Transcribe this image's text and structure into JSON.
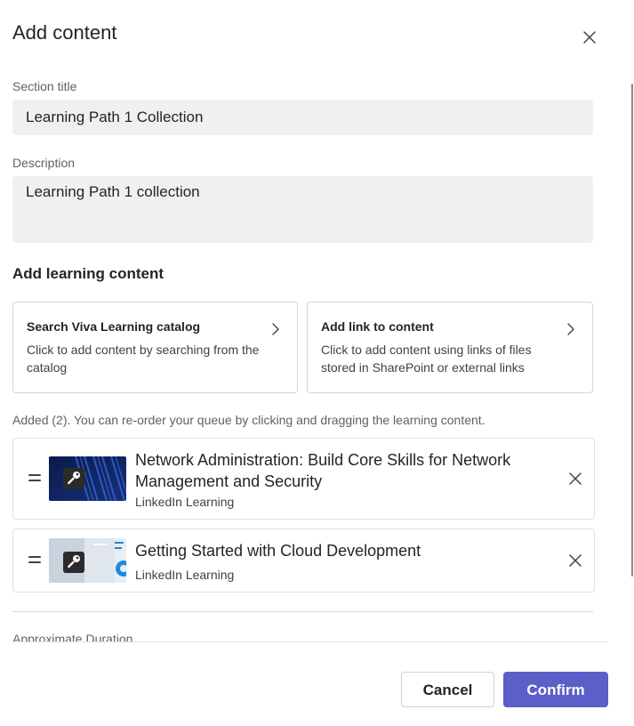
{
  "dialog": {
    "title": "Add content"
  },
  "form": {
    "section_title_label": "Section title",
    "section_title_value": "Learning Path 1 Collection",
    "description_label": "Description",
    "description_value": "Learning Path 1 collection"
  },
  "learning_content": {
    "heading": "Add learning content",
    "cards": [
      {
        "title": "Search Viva Learning catalog",
        "description": "Click to add content by searching from the catalog",
        "icon": "chevron-right-icon"
      },
      {
        "title": "Add link to content",
        "description": "Click to add content using links of files stored in SharePoint or external links",
        "icon": "chevron-right-icon"
      }
    ]
  },
  "queue": {
    "note": "Added (2). You can re-order your queue by clicking and dragging the learning content.",
    "items": [
      {
        "title": "Network Administration: Build Core Skills for Network Management and Security",
        "provider": "LinkedIn Learning",
        "badge_icon": "key-icon"
      },
      {
        "title": "Getting Started with Cloud Development",
        "provider": "LinkedIn Learning",
        "badge_icon": "key-icon"
      }
    ]
  },
  "duration": {
    "label": "Approximate Duration"
  },
  "footer": {
    "cancel_label": "Cancel",
    "confirm_label": "Confirm"
  },
  "colors": {
    "accent": "#5b5fc7",
    "input_background": "#f0f0f0",
    "border": "#d6d6d6"
  }
}
